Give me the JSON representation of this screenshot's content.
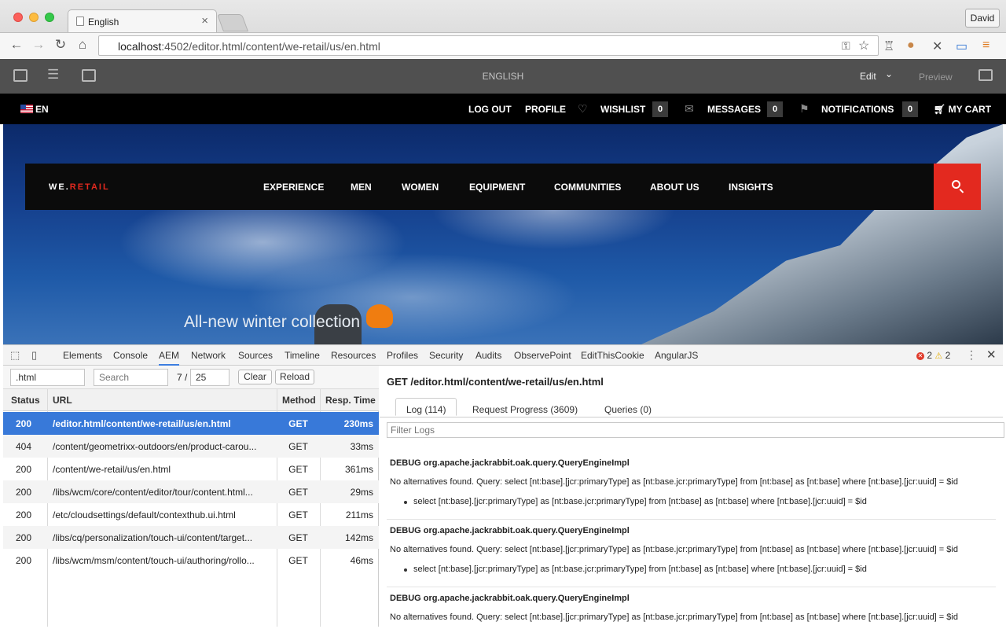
{
  "browser": {
    "tab_title": "English",
    "user": "David",
    "url_host": "localhost",
    "url_rest": ":4502/editor.html/content/we-retail/us/en.html"
  },
  "aem": {
    "title": "ENGLISH",
    "mode": "Edit",
    "preview": "Preview"
  },
  "site_top": {
    "lang": "EN",
    "logout": "LOG OUT",
    "profile": "PROFILE",
    "wishlist": "WISHLIST",
    "wishlist_count": "0",
    "messages": "MESSAGES",
    "messages_count": "0",
    "notifications": "NOTIFICATIONS",
    "notifications_count": "0",
    "cart": "MY CART"
  },
  "site_nav": {
    "logo_a": "WE.",
    "logo_b": "RETAIL",
    "items": [
      "EXPERIENCE",
      "MEN",
      "WOMEN",
      "EQUIPMENT",
      "COMMUNITIES",
      "ABOUT US",
      "INSIGHTS"
    ]
  },
  "hero": {
    "caption": "All-new winter collection"
  },
  "devtools": {
    "tabs": [
      "Elements",
      "Console",
      "AEM",
      "Network",
      "Sources",
      "Timeline",
      "Resources",
      "Profiles",
      "Security",
      "Audits",
      "ObservePoint",
      "EditThisCookie",
      "AngularJS"
    ],
    "errors": "2",
    "warnings": "2",
    "filter_value": ".html",
    "search_placeholder": "Search",
    "page_current": "7 /",
    "page_total": "25",
    "clear": "Clear",
    "reload": "Reload",
    "columns": {
      "status": "Status",
      "url": "URL",
      "method": "Method",
      "time": "Resp. Time"
    },
    "rows": [
      {
        "status": "200",
        "url": "/editor.html/content/we-retail/us/en.html",
        "method": "GET",
        "time": "230ms"
      },
      {
        "status": "404",
        "url": "/content/geometrixx-outdoors/en/product-carou...",
        "method": "GET",
        "time": "33ms"
      },
      {
        "status": "200",
        "url": "/content/we-retail/us/en.html",
        "method": "GET",
        "time": "361ms"
      },
      {
        "status": "200",
        "url": "/libs/wcm/core/content/editor/tour/content.html...",
        "method": "GET",
        "time": "29ms"
      },
      {
        "status": "200",
        "url": "/etc/cloudsettings/default/contexthub.ui.html",
        "method": "GET",
        "time": "211ms"
      },
      {
        "status": "200",
        "url": "/libs/cq/personalization/touch-ui/content/target...",
        "method": "GET",
        "time": "142ms"
      },
      {
        "status": "200",
        "url": "/libs/wcm/msm/content/touch-ui/authoring/rollo...",
        "method": "GET",
        "time": "46ms"
      }
    ],
    "request_title": "GET /editor.html/content/we-retail/us/en.html",
    "sub_tabs": [
      "Log (114)",
      "Request Progress (3609)",
      "Queries (0)"
    ],
    "filter_logs_placeholder": "Filter Logs",
    "logs": [
      {
        "head": "DEBUG org.apache.jackrabbit.oak.query.QueryEngineImpl",
        "msg": "No alternatives found. Query: select [nt:base].[jcr:primaryType] as [nt:base.jcr:primaryType] from [nt:base] as [nt:base] where [nt:base].[jcr:uuid] = $id",
        "bullet": "select [nt:base].[jcr:primaryType] as [nt:base.jcr:primaryType] from [nt:base] as [nt:base] where [nt:base].[jcr:uuid] = $id"
      },
      {
        "head": "DEBUG org.apache.jackrabbit.oak.query.QueryEngineImpl",
        "msg": "No alternatives found. Query: select [nt:base].[jcr:primaryType] as [nt:base.jcr:primaryType] from [nt:base] as [nt:base] where [nt:base].[jcr:uuid] = $id",
        "bullet": "select [nt:base].[jcr:primaryType] as [nt:base.jcr:primaryType] from [nt:base] as [nt:base] where [nt:base].[jcr:uuid] = $id"
      },
      {
        "head": "DEBUG org.apache.jackrabbit.oak.query.QueryEngineImpl",
        "msg": "No alternatives found. Query: select [nt:base].[jcr:primaryType] as [nt:base.jcr:primaryType] from [nt:base] as [nt:base] where [nt:base].[jcr:uuid] = $id",
        "bullet": ""
      }
    ]
  }
}
